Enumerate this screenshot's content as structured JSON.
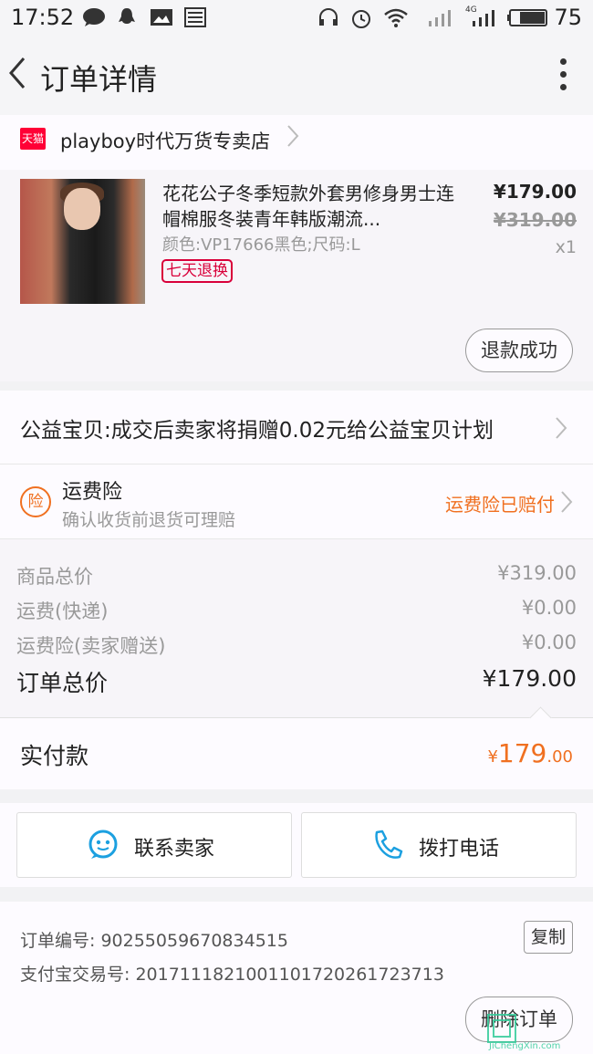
{
  "status_bar": {
    "time": "17:52",
    "network": "4G",
    "battery": "75"
  },
  "header": {
    "title": "订单详情"
  },
  "store": {
    "badge": "天猫",
    "name": "playboy时代万货专卖店"
  },
  "product": {
    "title": "花花公子冬季短款外套男修身男士连帽棉服冬装青年韩版潮流...",
    "spec": "颜色:VP17666黑色;尺码:L",
    "badge": "七天退换",
    "price": "¥179.00",
    "original_price": "¥319.00",
    "quantity": "x1",
    "refund_status": "退款成功"
  },
  "charity": {
    "text": "公益宝贝:成交后卖家将捐赠0.02元给公益宝贝计划"
  },
  "insurance": {
    "icon_char": "险",
    "title": "运费险",
    "subtitle": "确认收货前退货可理赔",
    "status": "运费险已赔付"
  },
  "price_details": [
    {
      "label": "商品总价",
      "value": "¥319.00"
    },
    {
      "label": "运费(快递)",
      "value": "¥0.00"
    },
    {
      "label": "运费险(卖家赠送)",
      "value": "¥0.00"
    }
  ],
  "order_total": {
    "label": "订单总价",
    "value": "¥179.00"
  },
  "paid": {
    "label": "实付款",
    "currency": "¥",
    "int": "179",
    "dec": ".00"
  },
  "actions": {
    "contact_seller": "联系卖家",
    "call_phone": "拨打电话"
  },
  "order_info": {
    "order_no_label": "订单编号:",
    "order_no": "90255059670834515",
    "alipay_no_label": "支付宝交易号:",
    "alipay_no": "2017111821001101720261723713",
    "copy": "复制",
    "delete": "删除订单"
  },
  "watermark": {
    "text": "JiChengXin.com"
  },
  "colors": {
    "accent_orange": "#f07020",
    "tmall_red": "#ff0036",
    "badge_red": "#d9003a",
    "icon_blue": "#1ca0e0"
  }
}
